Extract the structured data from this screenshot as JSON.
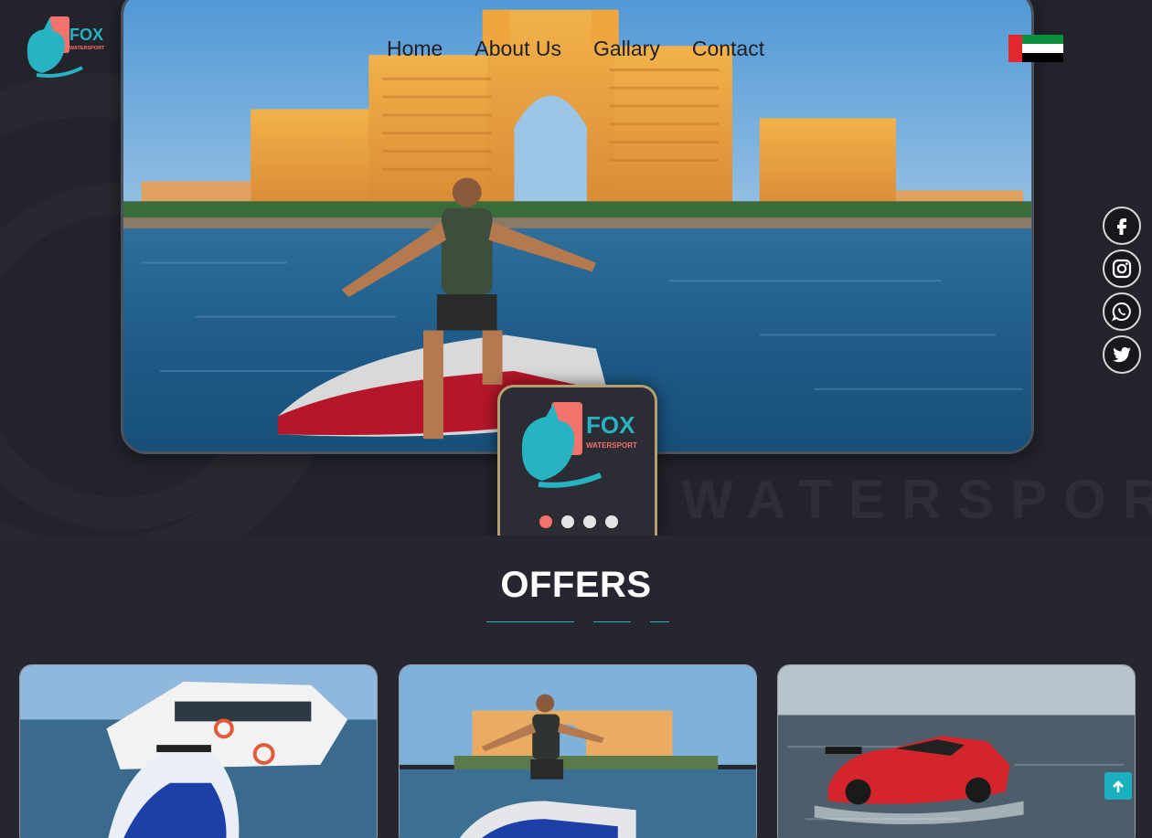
{
  "brand": {
    "logo_title": "FOX",
    "logo_subtitle": "WATERSPORT"
  },
  "nav": {
    "items": [
      {
        "label": "Home"
      },
      {
        "label": "About Us"
      },
      {
        "label": "Gallary"
      },
      {
        "label": "Contact"
      }
    ]
  },
  "language": {
    "flag_icon": "uae-flag-icon",
    "flag_colors": [
      "#e0282d",
      "#0a8f3a",
      "#ffffff",
      "#000000"
    ]
  },
  "social": {
    "items": [
      {
        "icon": "facebook-icon"
      },
      {
        "icon": "instagram-icon"
      },
      {
        "icon": "whatsapp-icon"
      },
      {
        "icon": "twitter-icon"
      }
    ]
  },
  "hero": {
    "watermark_text": "WATERSPORT",
    "carousel": {
      "slide_count": 4,
      "active_index": 0
    }
  },
  "offers": {
    "title": "OFFERS",
    "cards": [
      {
        "image": "yacht-and-jetski-photo"
      },
      {
        "image": "rider-on-jetski-atlantis-photo"
      },
      {
        "image": "red-jet-car-photo"
      }
    ]
  },
  "colors": {
    "background": "#262630",
    "accent_teal": "#1ab0c0",
    "accent_coral": "#f2726c",
    "card_border_gold": "#b3a070"
  },
  "back_to_top": {
    "icon": "arrow-up-icon"
  }
}
